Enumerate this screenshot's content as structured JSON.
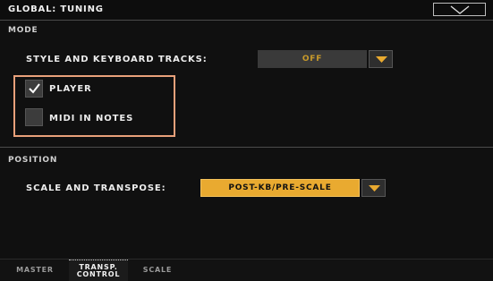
{
  "header": {
    "title": "GLOBAL: TUNING"
  },
  "mode": {
    "section_label": "MODE",
    "style_kb_tracks_label": "STYLE AND KEYBOARD TRACKS:",
    "style_kb_tracks_value": "OFF",
    "player_label": "PLAYER",
    "player_checked": true,
    "midi_in_notes_label": "MIDI IN NOTES",
    "midi_in_notes_checked": false
  },
  "position": {
    "section_label": "POSITION",
    "scale_transpose_label": "SCALE AND TRANSPOSE:",
    "scale_transpose_value": "POST-KB/PRE-SCALE"
  },
  "tabs": [
    {
      "label": "MASTER"
    },
    {
      "label_line1": "TRANSP.",
      "label_line2": "CONTROL"
    },
    {
      "label": "SCALE"
    }
  ],
  "colors": {
    "accent": "#e9aa30",
    "highlight_frame": "#e8a07a"
  },
  "icons": {
    "menu": "chevron-down-icon",
    "dropdown": "triangle-down-icon",
    "check": "checkmark-icon"
  }
}
